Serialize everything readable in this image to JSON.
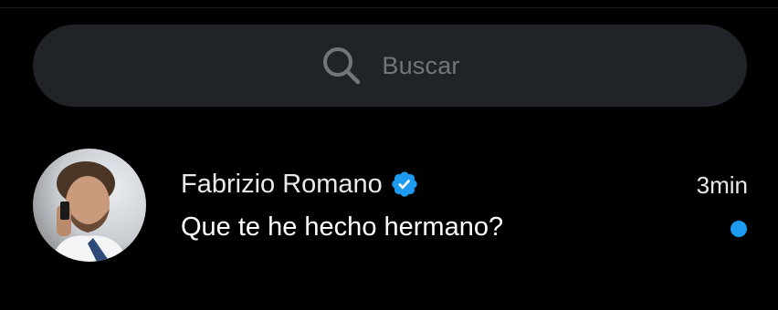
{
  "search": {
    "placeholder": "Buscar",
    "icon": "search-icon"
  },
  "conversation": {
    "sender_name": "Fabrizio Romano",
    "verified": true,
    "timestamp": "3min",
    "preview": "Que te he hecho hermano?",
    "unread": true
  },
  "colors": {
    "background": "#000000",
    "search_bar": "#202327",
    "placeholder_text": "#71767b",
    "primary_text": "#e7e9ea",
    "accent_blue": "#1d9bf0"
  }
}
